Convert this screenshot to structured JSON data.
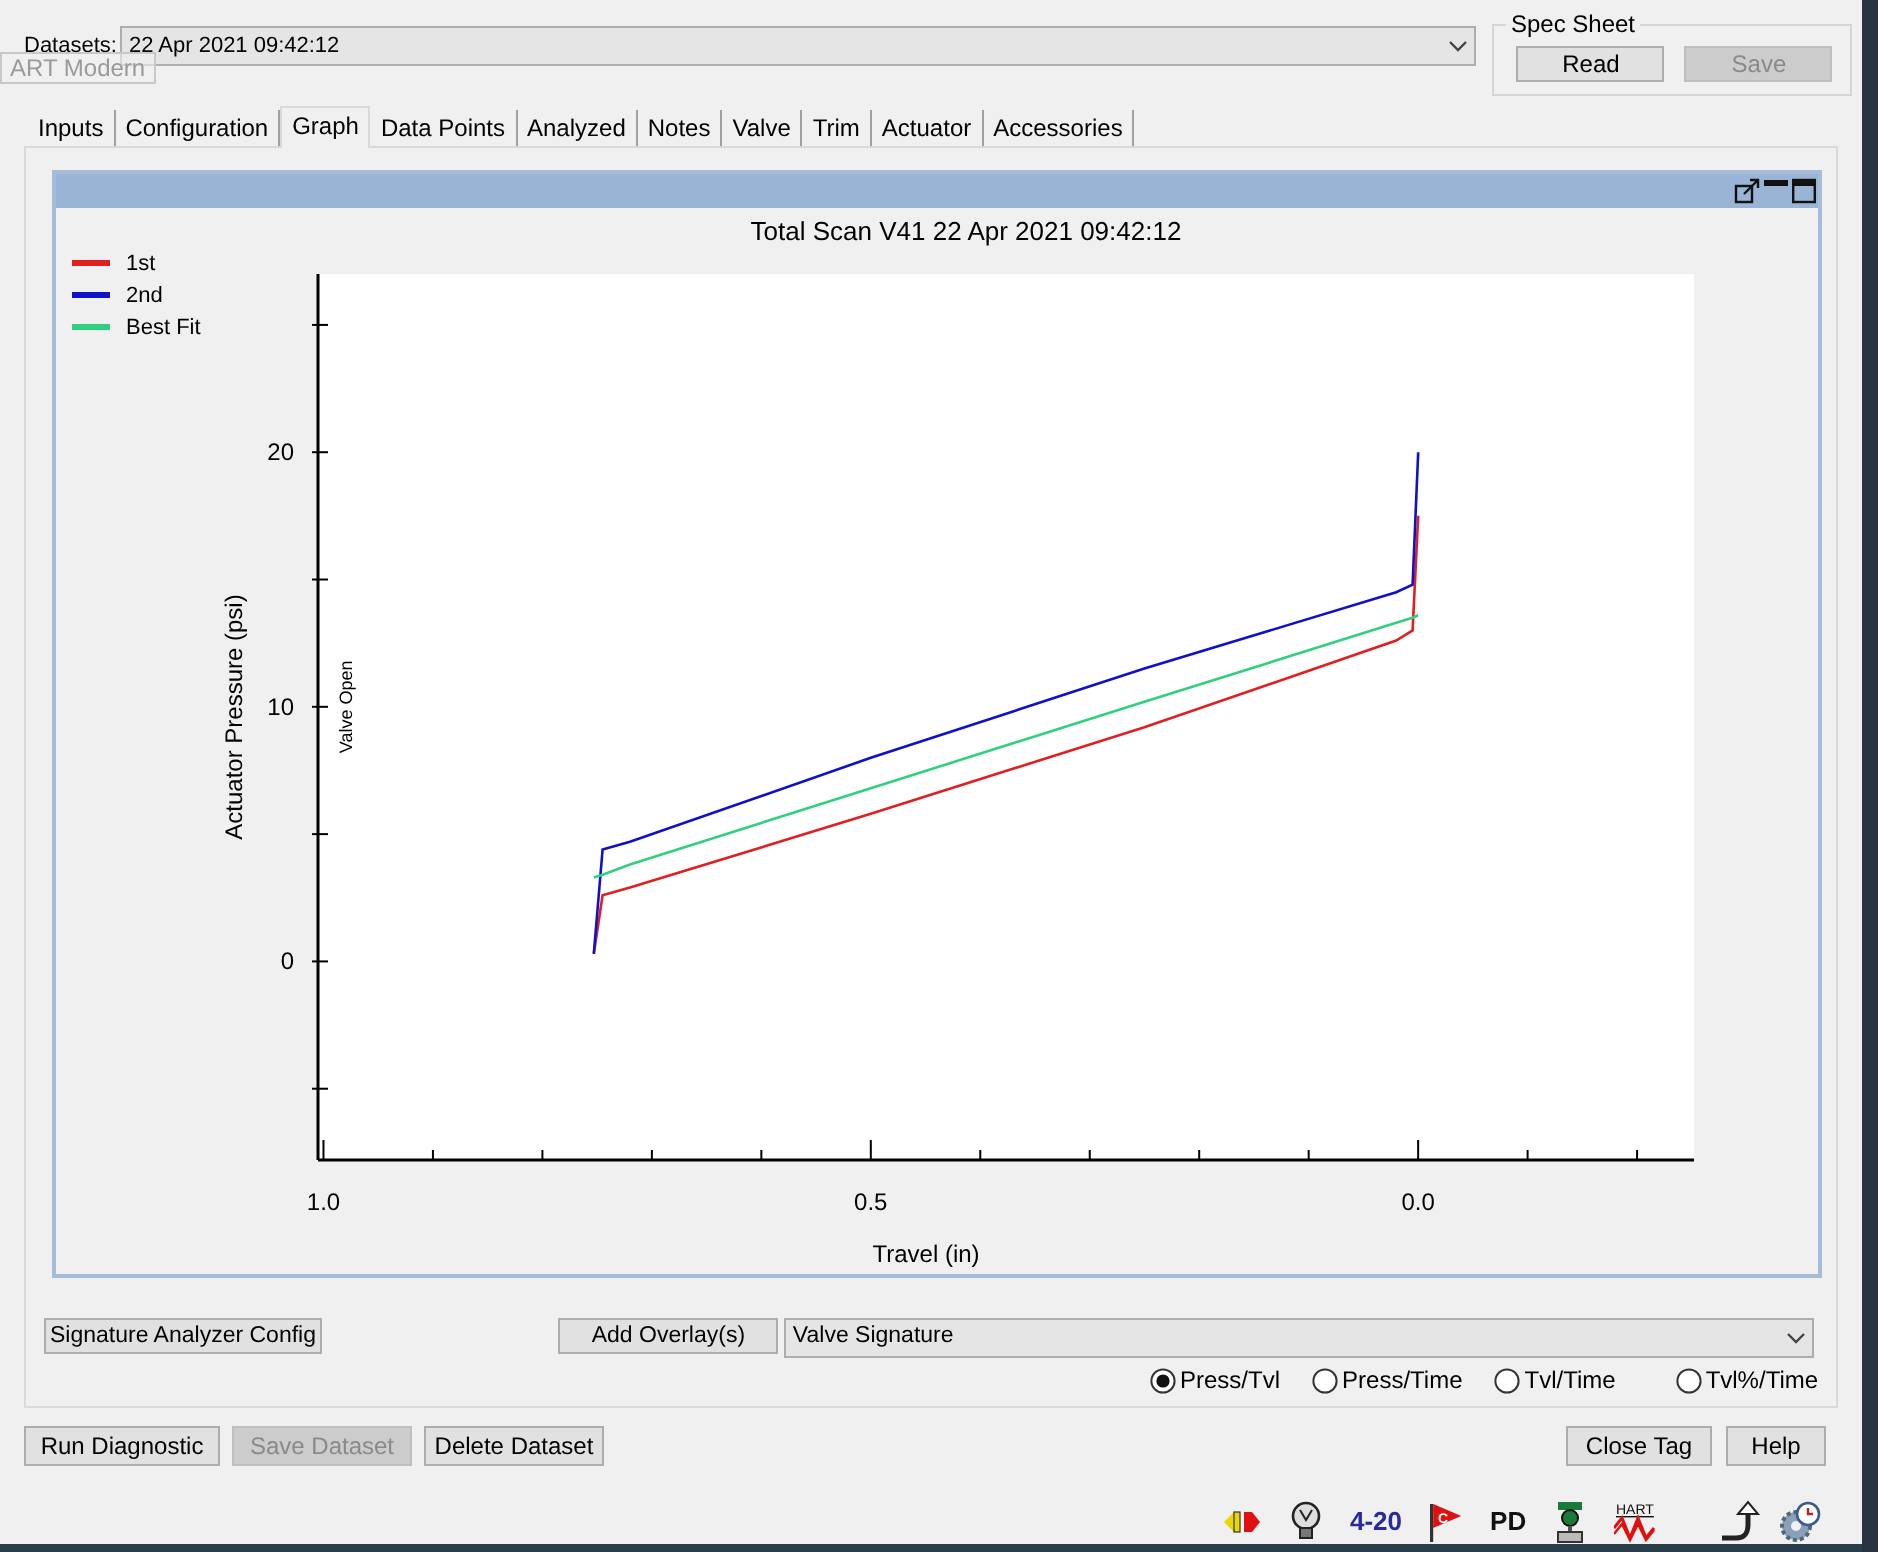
{
  "datasets": {
    "label": "Datasets:",
    "value": "22 Apr 2021 09:42:12"
  },
  "overlay_label": "ART Modern",
  "spec_sheet": {
    "title": "Spec Sheet",
    "buttons": [
      {
        "label": "Read",
        "disabled": false
      },
      {
        "label": "Save",
        "disabled": true
      }
    ]
  },
  "tabs": [
    {
      "label": "Inputs",
      "selected": false
    },
    {
      "label": "Configuration",
      "selected": false
    },
    {
      "label": "Graph",
      "selected": true
    },
    {
      "label": "Data Points",
      "selected": false
    },
    {
      "label": "Analyzed",
      "selected": false
    },
    {
      "label": "Notes",
      "selected": false
    },
    {
      "label": "Valve",
      "selected": false
    },
    {
      "label": "Trim",
      "selected": false
    },
    {
      "label": "Actuator",
      "selected": false
    },
    {
      "label": "Accessories",
      "selected": false
    }
  ],
  "graph": {
    "chart_data": {
      "type": "line",
      "title": "Total Scan V41 22 Apr 2021 09:42:12",
      "xlabel": "Travel (in)",
      "ylabel": "Actuator Pressure (psi)",
      "x": [
        0.753,
        0.745,
        0.72,
        0.5,
        0.25,
        0.02,
        0.005,
        0.0
      ],
      "series": [
        {
          "name": "1st",
          "color": "#e02020",
          "values": [
            0.3,
            2.6,
            2.9,
            5.8,
            9.2,
            12.6,
            13.0,
            17.5
          ]
        },
        {
          "name": "2nd",
          "color": "#1010c8",
          "values": [
            0.3,
            4.4,
            4.7,
            8.0,
            11.5,
            14.5,
            14.8,
            20.0
          ]
        },
        {
          "name": "Best Fit",
          "color": "#30d080",
          "values": [
            3.3,
            3.4,
            3.8,
            6.8,
            10.2,
            13.3,
            13.5,
            13.6
          ]
        }
      ],
      "xlim": [
        1.005,
        -0.252
      ],
      "ylim": [
        -7.8,
        27
      ],
      "xticks": [
        {
          "value": 1.0,
          "label": "1.0"
        },
        {
          "value": 0.5,
          "label": "0.5"
        },
        {
          "value": 0.0,
          "label": "0.0"
        }
      ],
      "yticks": [
        0,
        10,
        20
      ],
      "annotations": [
        "Valve Open"
      ],
      "legend": true
    }
  },
  "signature_button": "Signature Analyzer Config",
  "overlay_button": "Add Overlay(s)",
  "plot_select": "Valve Signature",
  "plot_modes": [
    {
      "label": "Press/Tvl",
      "selected": true
    },
    {
      "label": "Press/Time",
      "selected": false
    },
    {
      "label": "Tvl/Time",
      "selected": false
    },
    {
      "label": "Tvl%/Time",
      "selected": false
    }
  ],
  "actions": [
    {
      "label": "Run Diagnostic",
      "disabled": false
    },
    {
      "label": "Save Dataset",
      "disabled": true
    },
    {
      "label": "Delete Dataset",
      "disabled": false
    }
  ],
  "right_actions": [
    {
      "label": "Close Tag",
      "disabled": false
    },
    {
      "label": "Help",
      "disabled": false
    }
  ],
  "status_icons": [
    {
      "kind": "plug"
    },
    {
      "kind": "bulb"
    },
    {
      "kind": "text",
      "text": "4-20"
    },
    {
      "kind": "flag",
      "text": "C"
    },
    {
      "kind": "text",
      "text": "PD"
    },
    {
      "kind": "valve"
    },
    {
      "kind": "hart",
      "text": "HART"
    }
  ],
  "status_right_icons": [
    {
      "kind": "arrow"
    },
    {
      "kind": "gear"
    }
  ]
}
